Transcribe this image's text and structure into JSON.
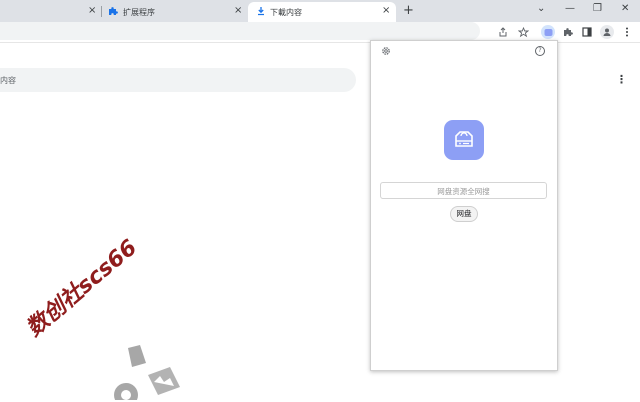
{
  "tabs": [
    {
      "title": "扩展程序",
      "icon": "puzzle-icon",
      "close": "×"
    },
    {
      "title": "下載内容",
      "icon": "download-icon",
      "close": "×",
      "active": true
    }
  ],
  "tab_partial_close": "×",
  "new_tab_label": "+",
  "window_controls": {
    "dropdown": "⌄",
    "minimize": "—",
    "restore": "❐",
    "close": "✕"
  },
  "toolbar_icons": [
    "share-icon",
    "bookmark-star-icon",
    "extension-active-icon",
    "extensions-puzzle-icon",
    "side-panel-icon",
    "profile-icon",
    "menu-kebab-icon"
  ],
  "page": {
    "search_placeholder_visible": "内容",
    "menu_label": "⋮"
  },
  "popup": {
    "settings_icon": "gear-icon",
    "help_icon": "help-icon",
    "help_glyph": "?",
    "app_icon": "cloud-drive-icon",
    "search_placeholder": "网盘资源全网搜",
    "chip_label": "网盘"
  },
  "watermark": "数创社scs66",
  "colors": {
    "accent": "#8d9ff5",
    "tab_download_blue": "#1a73e8",
    "tabstrip": "#dee1e6"
  }
}
